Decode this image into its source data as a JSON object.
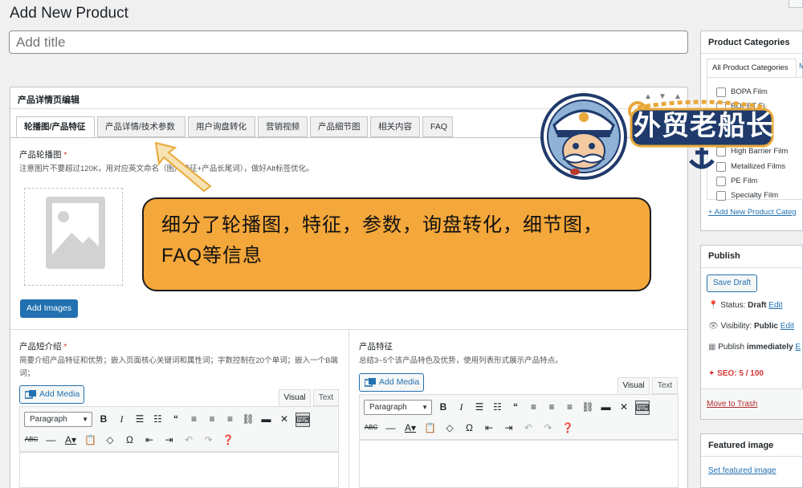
{
  "page": {
    "title": "Add New Product"
  },
  "title_field": {
    "placeholder": "Add title"
  },
  "metabox": {
    "title": "产品详情页编辑",
    "tabs": [
      "轮播图/产品特征",
      "产品详情/技术参数",
      "用户询盘转化",
      "营销视频",
      "产品细节图",
      "相关内容",
      "FAQ"
    ],
    "carousel": {
      "label": "产品轮播图",
      "required": "*",
      "note": "注意图片不要超过120K，用对应英文命名（图片特征+产品长尾词），做好Alt标签优化。",
      "add_images": "Add Images"
    },
    "short_intro": {
      "label": "产品短介绍",
      "required": "*",
      "note": "简要介绍产品特征和优势；嵌入页面核心关键词和属性词；字数控制在20个单词；嵌入一个B端词；"
    },
    "features": {
      "label": "产品特征",
      "note": "总结3~5个该产品特色及优势，使用列表形式展示产品特点。"
    }
  },
  "editor": {
    "add_media": "Add Media",
    "visual_tab": "Visual",
    "text_tab": "Text",
    "format_select": "Paragraph"
  },
  "sidebar": {
    "categories": {
      "title": "Product Categories",
      "tab_all": "All Product Categories",
      "tab_most": "M",
      "items": [
        "BOPA Film",
        "BOPET Fi",
        "",
        "High Barrier Film",
        "Metallized Films",
        "PE Film",
        "Specialty Film"
      ],
      "add_new": "+ Add New Product Categ"
    },
    "publish": {
      "title": "Publish",
      "save_draft": "Save Draft",
      "status_label": "Status:",
      "status_value": "Draft",
      "visibility_label": "Visibility:",
      "visibility_value": "Public",
      "publish_label": "Publish",
      "publish_value": "immediately",
      "edit": "Edit",
      "edit_short": "E",
      "seo": "SEO: 5 / 100",
      "move_to_trash": "Move to Trash"
    },
    "featured_image": {
      "title": "Featured image",
      "set_link": "Set featured image"
    }
  },
  "overlay": {
    "callout_text": "细分了轮播图，特征，参数，询盘转化，细节图，FAQ等信息",
    "logo_text": "外贸老船长"
  },
  "colors": {
    "accent": "#2271b1",
    "callout": "#f4a73a",
    "seo_red": "#d63638"
  }
}
